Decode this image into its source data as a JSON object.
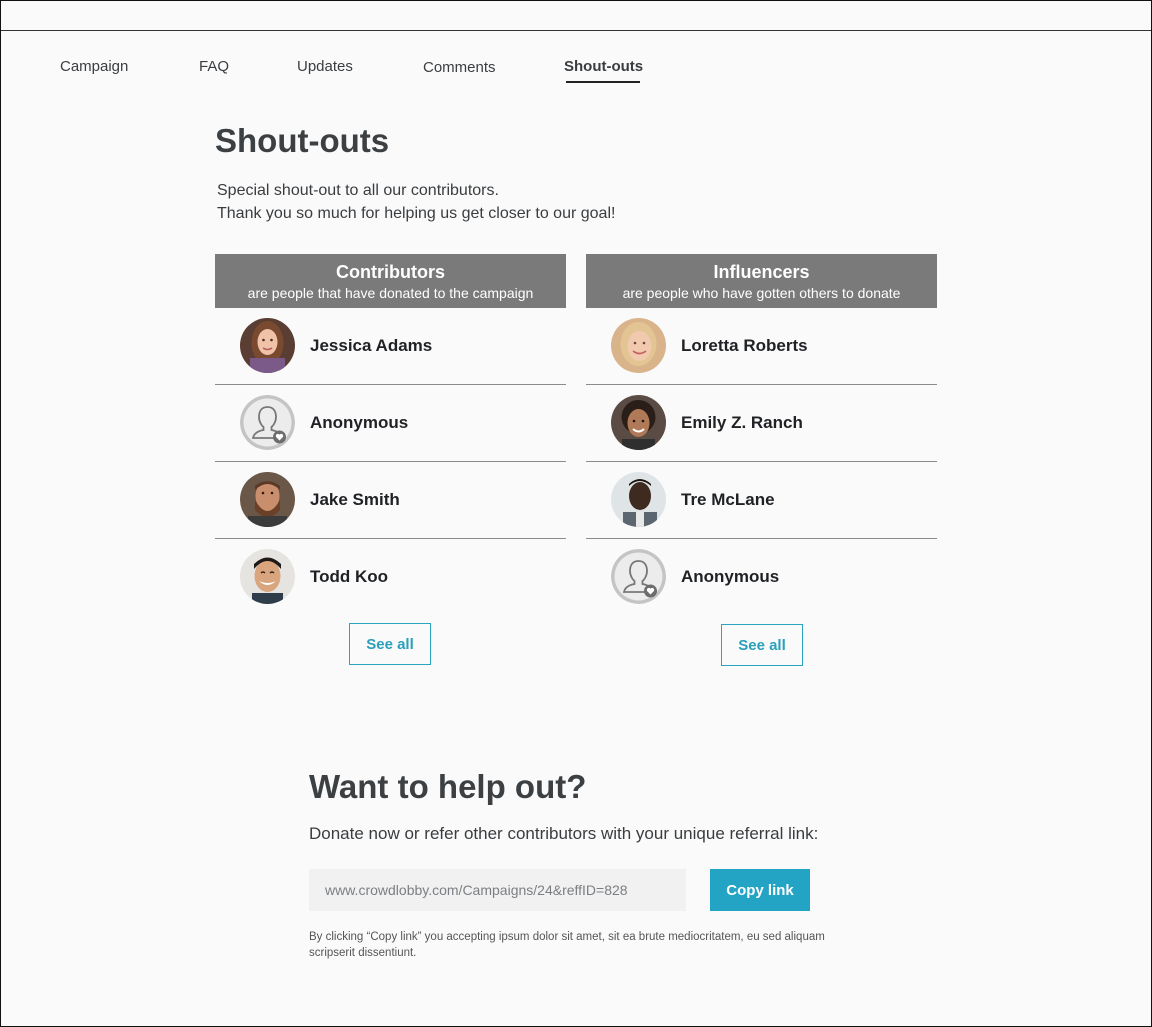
{
  "tabs": [
    {
      "label": "Campaign"
    },
    {
      "label": "FAQ"
    },
    {
      "label": "Updates"
    },
    {
      "label": "Comments"
    },
    {
      "label": "Shout-outs",
      "active": true
    }
  ],
  "page": {
    "title": "Shout-outs",
    "intro_line1": "Special shout-out to all our contributors.",
    "intro_line2": "Thank you so much for helping us get closer to our goal!"
  },
  "contributors": {
    "title": "Contributors",
    "subtitle": "are people that have donated to the campaign",
    "people": [
      {
        "name": "Jessica Adams",
        "avatar": "photo-woman-young"
      },
      {
        "name": "Anonymous",
        "avatar": "anonymous-icon"
      },
      {
        "name": "Jake Smith",
        "avatar": "photo-man-beard"
      },
      {
        "name": "Todd Koo",
        "avatar": "photo-man-smiling"
      }
    ],
    "see_all_label": "See all"
  },
  "influencers": {
    "title": "Influencers",
    "subtitle": "are people who have gotten others to donate",
    "people": [
      {
        "name": "Loretta Roberts",
        "avatar": "photo-woman-blonde"
      },
      {
        "name": "Emily Z. Ranch",
        "avatar": "photo-woman-dark-hair"
      },
      {
        "name": "Tre McLane",
        "avatar": "photo-man-dark"
      },
      {
        "name": "Anonymous",
        "avatar": "anonymous-icon"
      }
    ],
    "see_all_label": "See all"
  },
  "help": {
    "title": "Want to help out?",
    "subtitle": "Donate now or refer other contributors with your unique referral link:",
    "referral_link": "www.crowdlobby.com/Campaigns/24&reffID=828",
    "copy_label": "Copy link",
    "disclaimer": "By clicking “Copy link” you accepting ipsum dolor sit amet, sit ea brute mediocritatem, eu sed aliquam scripserit dissentiunt."
  },
  "colors": {
    "accent": "#23a4c4",
    "header_bg": "#7a7a7a",
    "page_bg": "#fafafa"
  }
}
